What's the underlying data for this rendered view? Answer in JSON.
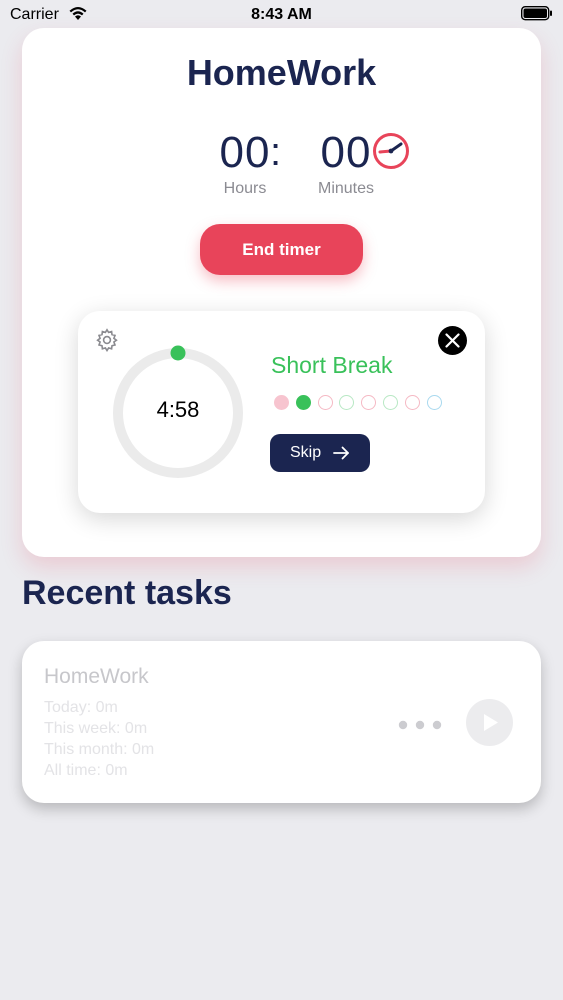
{
  "status_bar": {
    "carrier": "Carrier",
    "time": "8:43 AM"
  },
  "timer": {
    "title": "HomeWork",
    "hours": "00",
    "separator": ":",
    "minutes": "00",
    "hours_label": "Hours",
    "minutes_label": "Minutes",
    "end_button_label": "End timer",
    "accent_color": "#e8445a"
  },
  "break_popup": {
    "countdown": "4:58",
    "title": "Short Break",
    "title_color": "#39c15a",
    "progress_fraction": 0.0,
    "skip_label": "Skip",
    "session_dots": [
      {
        "color": "#f7c4cf",
        "filled": true
      },
      {
        "color": "#39c15a",
        "filled": true
      },
      {
        "color": "#f5b9c4",
        "filled": false
      },
      {
        "color": "#b8e8c4",
        "filled": false
      },
      {
        "color": "#f5b9c4",
        "filled": false
      },
      {
        "color": "#b8e8c4",
        "filled": false
      },
      {
        "color": "#f5b9c4",
        "filled": false
      },
      {
        "color": "#a9d9ef",
        "filled": false
      }
    ]
  },
  "recent": {
    "title": "Recent tasks",
    "tasks": [
      {
        "name": "HomeWork",
        "today": "Today: 0m",
        "week": "This week: 0m",
        "month": "This month: 0m",
        "all_time": "All time: 0m"
      }
    ]
  },
  "colors": {
    "navy": "#1b2550",
    "background": "#ebebef"
  }
}
